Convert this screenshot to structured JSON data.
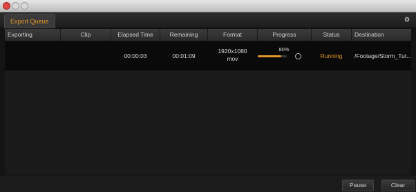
{
  "window": {
    "tab_label": "Export Queue"
  },
  "columns": [
    "Exporting",
    "Clip",
    "Elapsed Time",
    "Remaining",
    "Format",
    "Progress",
    "Status",
    "Destination"
  ],
  "job": {
    "elapsed": "00:00:03",
    "remaining": "00:01:09",
    "format_res": "1920x1080",
    "format_ext": "mov",
    "progress_label": "80%",
    "progress_value": 0.8,
    "status": "Running",
    "destination": "/Footage/Storm_Tut..."
  },
  "buttons": {
    "pause": "Pause",
    "clear": "Clear"
  },
  "colors": {
    "accent": "#e2962a"
  },
  "icons": {
    "tab_action": "gear-icon",
    "cancel": "cancel-circle-icon"
  }
}
